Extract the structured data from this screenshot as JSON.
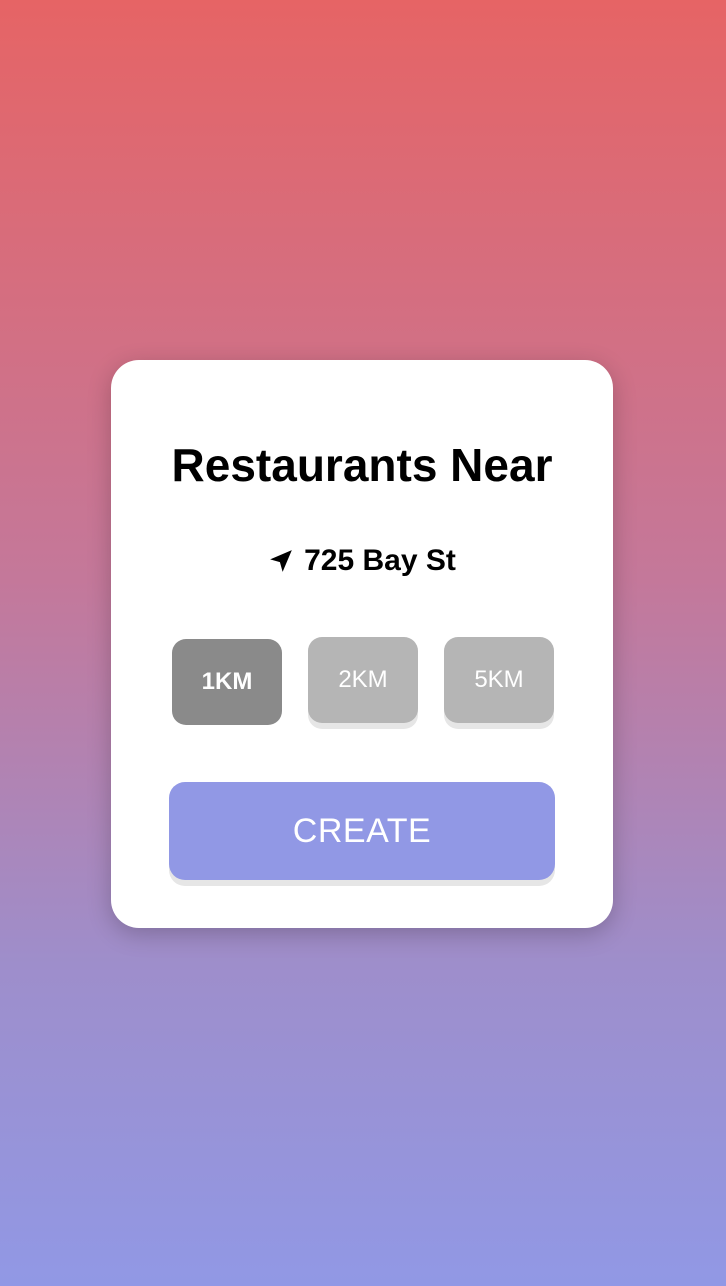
{
  "card": {
    "title": "Restaurants Near",
    "location_icon": "location-arrow-icon",
    "location": "725 Bay St"
  },
  "distances": {
    "options": [
      "1KM",
      "2KM",
      "5KM"
    ],
    "selected": "1KM"
  },
  "create_label": "CREATE",
  "colors": {
    "gradient_top": "#e66465",
    "gradient_bottom": "#9198e5",
    "selected_button": "#8a8a8a",
    "unselected_button": "#b5b5b5",
    "create_button": "#9198e5"
  }
}
